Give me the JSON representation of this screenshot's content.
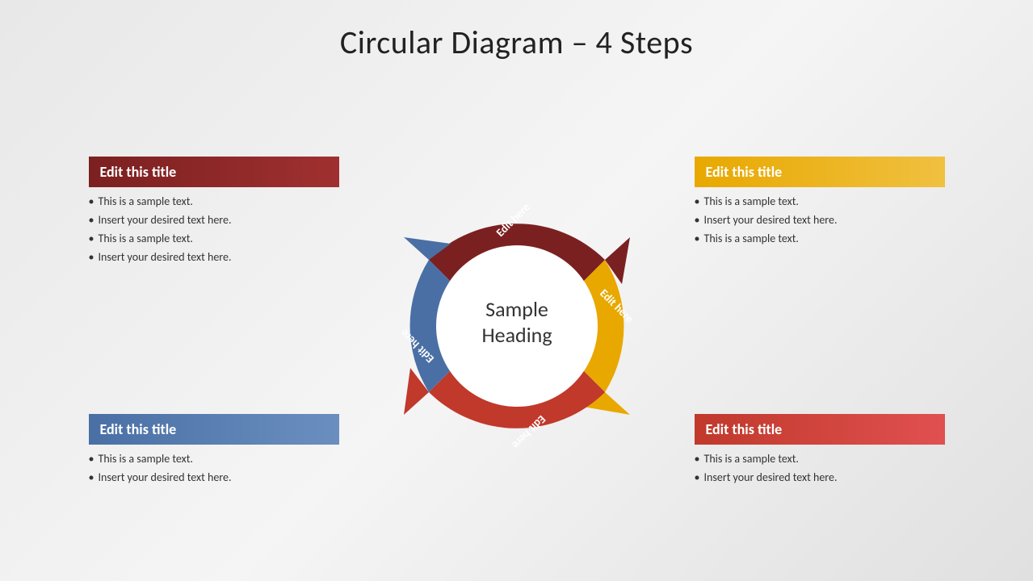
{
  "slide": {
    "main_title": "Circular Diagram – 4 Steps",
    "center_heading_line1": "Sample",
    "center_heading_line2": "Heading",
    "panels": {
      "top_left": {
        "title": "Edit this title",
        "title_class": "dark-red",
        "bullets": [
          "This is a sample text.",
          "Insert your desired text here.",
          "This is a sample text.",
          "Insert your desired text here."
        ]
      },
      "top_right": {
        "title": "Edit this title",
        "title_class": "yellow",
        "bullets": [
          "This is a sample text.",
          "Insert your desired text here.",
          "This is a sample text."
        ]
      },
      "bottom_left": {
        "title": "Edit this title",
        "title_class": "blue-gray",
        "bullets": [
          "This is a sample text.",
          "Insert your desired text here."
        ]
      },
      "bottom_right": {
        "title": "Edit this title",
        "title_class": "red",
        "bullets": [
          "This is a sample text.",
          "Insert your desired text here."
        ]
      }
    },
    "arrows": {
      "top": {
        "label": "Edit here",
        "color": "#7b2020"
      },
      "right": {
        "label": "Edit here",
        "color": "#e8a800"
      },
      "bottom": {
        "label": "Edit here",
        "color": "#c0392b"
      },
      "left": {
        "label": "Edit here",
        "color": "#4a6fa5"
      }
    }
  }
}
